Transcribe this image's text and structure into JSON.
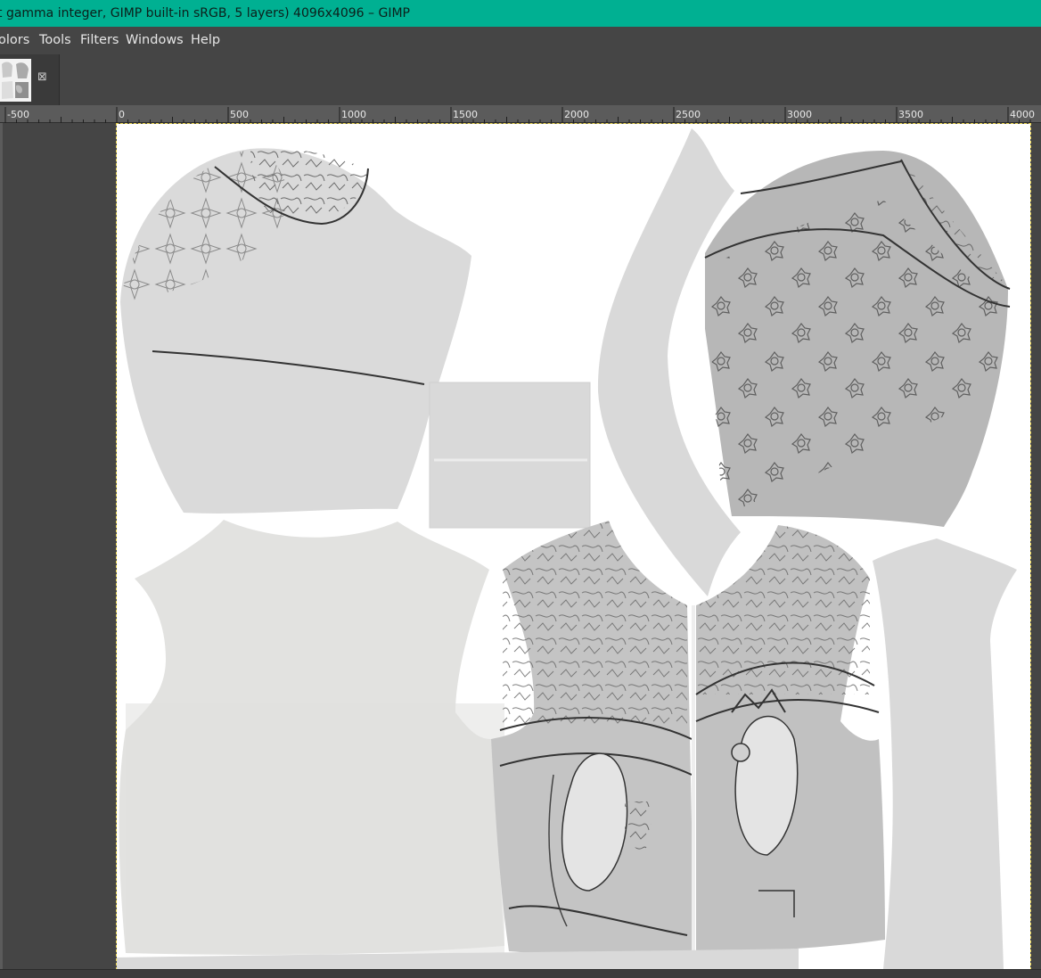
{
  "window": {
    "title": "t gamma integer, GIMP built-in sRGB, 5 layers) 4096x4096 – GIMP"
  },
  "menu": [
    {
      "id": "colors",
      "label": "olors"
    },
    {
      "id": "tools",
      "label": "Tools"
    },
    {
      "id": "filters",
      "label": "Filters"
    },
    {
      "id": "windows",
      "label": "Windows"
    },
    {
      "id": "help",
      "label": "Help"
    }
  ],
  "tab": {
    "thumbnail_icon": "texture-thumbnail",
    "close_icon": "close-icon"
  },
  "ruler": {
    "labels": [
      "-500",
      "0",
      "500",
      "1000",
      "1500",
      "2000",
      "2500",
      "3000",
      "3500",
      "4000"
    ]
  },
  "canvas": {
    "background": "#ffffff",
    "pattern_color": "#dadada",
    "line_color": "#333333",
    "accent_title": "#00b092"
  }
}
